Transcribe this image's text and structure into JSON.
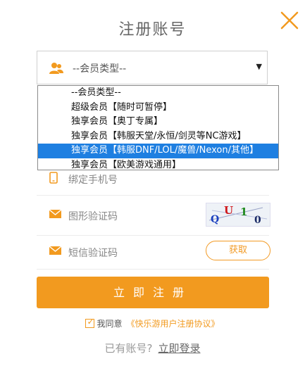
{
  "title": "注册账号",
  "member_select": {
    "value": "--会员类型--",
    "options": [
      "--会员类型--",
      "超级会员【随时可暂停】",
      "独享会员【奥丁专属】",
      "独享会员【韩服天堂/永恒/剑灵等NC游戏】",
      "独享会员【韩服DNF/LOL/魔兽/Nexon/其他】",
      "独享会员【欧美游戏通用】"
    ],
    "highlighted_index": 4
  },
  "phone": {
    "placeholder": "绑定手机号"
  },
  "captcha": {
    "placeholder": "图形验证码",
    "chars": [
      "Q",
      "U",
      "1",
      "0"
    ]
  },
  "sms": {
    "placeholder": "短信验证码",
    "button_label": "获取"
  },
  "submit_label": "立即注册",
  "agreement": {
    "prefix": "我同意",
    "link_text": "《快乐游用户注册协议》"
  },
  "login": {
    "prefix": "已有账号?",
    "link_text": "立即登录"
  },
  "colors": {
    "accent": "#f29a1f",
    "highlight": "#1e7fe1",
    "captcha_chars": [
      "#1a3fbf",
      "#d0181c",
      "#1f8a1f",
      "#1a2a66"
    ]
  },
  "icons": {
    "close": "close-icon",
    "member": "users-icon",
    "phone": "phone-icon",
    "mail": "mail-icon",
    "dropdown": "triangle-down-icon",
    "check": "checkmark-icon"
  }
}
